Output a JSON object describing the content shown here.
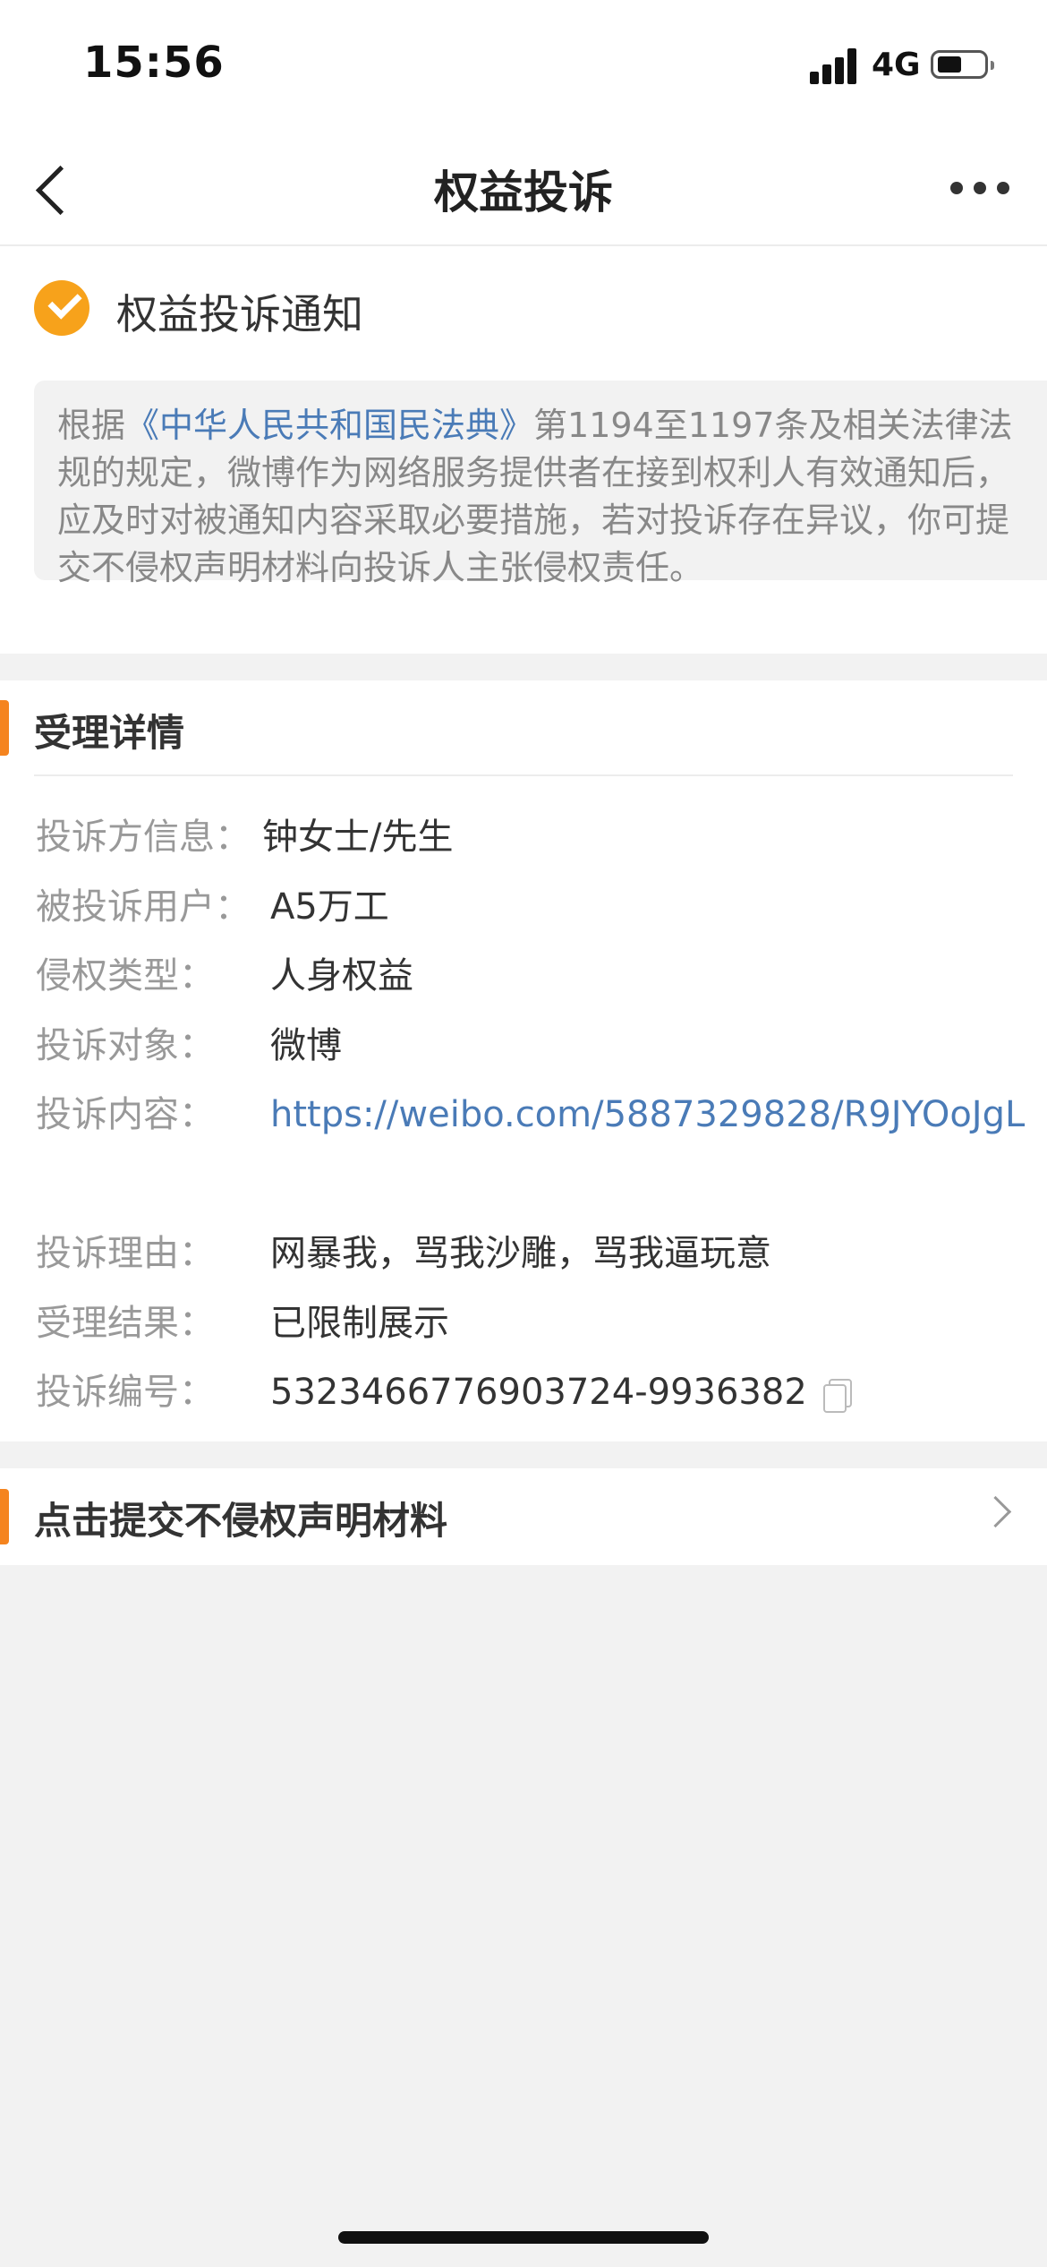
{
  "status_bar": {
    "time": "15:56",
    "network": "4G"
  },
  "nav": {
    "title": "权益投诉"
  },
  "notice": {
    "title": "权益投诉通知",
    "text_prefix": "根据",
    "law_link": "《中华人民共和国民法典》",
    "text_suffix": "第1194至1197条及相关法律法规的规定，微博作为网络服务提供者在接到权利人有效通知后，应及时对被通知内容采取必要措施，若对投诉存在异议，你可提交不侵权声明材料向投诉人主张侵权责任。"
  },
  "detail": {
    "section_title": "受理详情",
    "rows": [
      {
        "label": "投诉方信息：",
        "value": "钟女士/先生"
      },
      {
        "label": "被投诉用户：",
        "value": "A5万工"
      },
      {
        "label": "侵权类型：",
        "value": "人身权益"
      },
      {
        "label": "投诉对象：",
        "value": "微博"
      },
      {
        "label": "投诉内容：",
        "value": "https://weibo.com/5887329828/R9JYOoJgL"
      },
      {
        "label": "投诉理由：",
        "value": "网暴我，骂我沙雕，骂我逼玩意"
      },
      {
        "label": "受理结果：",
        "value": "已限制展示"
      },
      {
        "label": "投诉编号：",
        "value": "5323466776903724-9936382"
      }
    ]
  },
  "action": {
    "label": "点击提交不侵权声明材料"
  },
  "colors": {
    "accent": "#f5841f",
    "check": "#f7a21b",
    "link": "#4a7bb7"
  },
  "icons": [
    "back-icon",
    "more-icon",
    "check-icon",
    "copy-icon",
    "chevron-right-icon"
  ]
}
